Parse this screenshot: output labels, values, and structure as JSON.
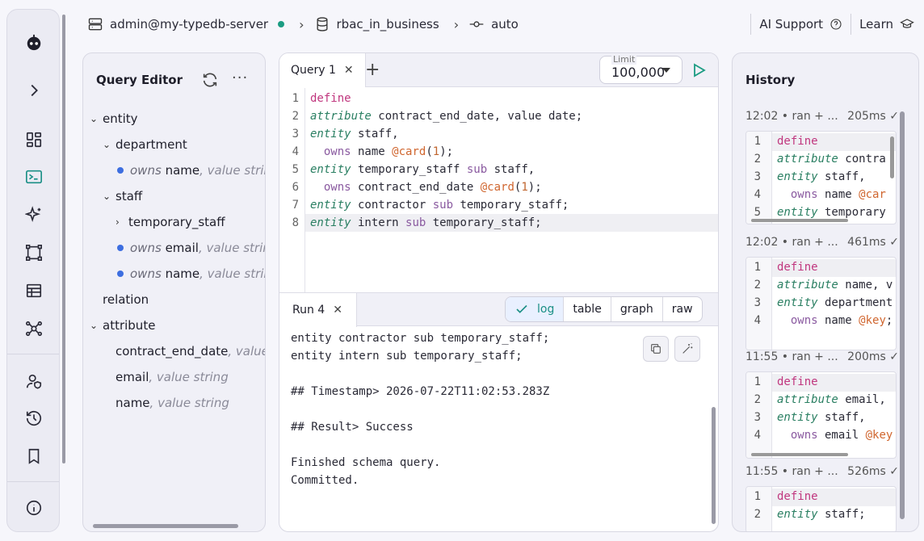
{
  "topbar": {
    "server": "admin@my-typedb-server",
    "database": "rbac_in_business",
    "transaction": "auto",
    "ai_support": "AI Support",
    "learn": "Learn"
  },
  "query_editor": {
    "title": "Query Editor",
    "tree": [
      {
        "label": "entity"
      },
      {
        "label": "department"
      },
      {
        "owns": "owns",
        "name": "name",
        "value": ", value string"
      },
      {
        "label": "staff"
      },
      {
        "label": "temporary_staff"
      },
      {
        "owns": "owns",
        "name": "email",
        "value": ", value string"
      },
      {
        "owns": "owns",
        "name": "name",
        "value": ", value string"
      },
      {
        "label": "relation"
      },
      {
        "label": "attribute"
      },
      {
        "name": "contract_end_date",
        "value": ", value d"
      },
      {
        "name": "email",
        "value": ", value string"
      },
      {
        "name": "name",
        "value": ", value string"
      }
    ]
  },
  "editor": {
    "tab_label": "Query 1",
    "limit_label": "Limit",
    "limit_value": "100,000",
    "line_numbers": [
      "1",
      "2",
      "3",
      "4",
      "5",
      "6",
      "7",
      "8"
    ],
    "run_tab": "Run 4",
    "views": [
      "log",
      "table",
      "graph",
      "raw"
    ],
    "log_lines": [
      "entity contractor sub temporary_staff;",
      "entity intern sub temporary_staff;",
      "",
      "## Timestamp> 2026-07-22T11:02:53.283Z",
      "",
      "## Result> Success",
      "",
      "Finished schema query.",
      "Committed."
    ]
  },
  "history": {
    "title": "History",
    "entries": [
      {
        "time": "12:02 • ran + ...",
        "duration": "205ms",
        "lines": [
          "define",
          "attribute contra",
          "entity staff,",
          "  owns name @car",
          "entity temporary"
        ]
      },
      {
        "time": "12:02 • ran + ...",
        "duration": "461ms",
        "lines": [
          "define",
          "attribute name, v",
          "entity department",
          "  owns name @key;"
        ]
      },
      {
        "time": "11:55 • ran + ...",
        "duration": "200ms",
        "lines": [
          "define",
          "attribute email,",
          "entity staff,",
          "  owns email @key"
        ]
      },
      {
        "time": "11:55 • ran + ...",
        "duration": "526ms",
        "lines": [
          "define",
          "entity staff;"
        ]
      }
    ]
  }
}
